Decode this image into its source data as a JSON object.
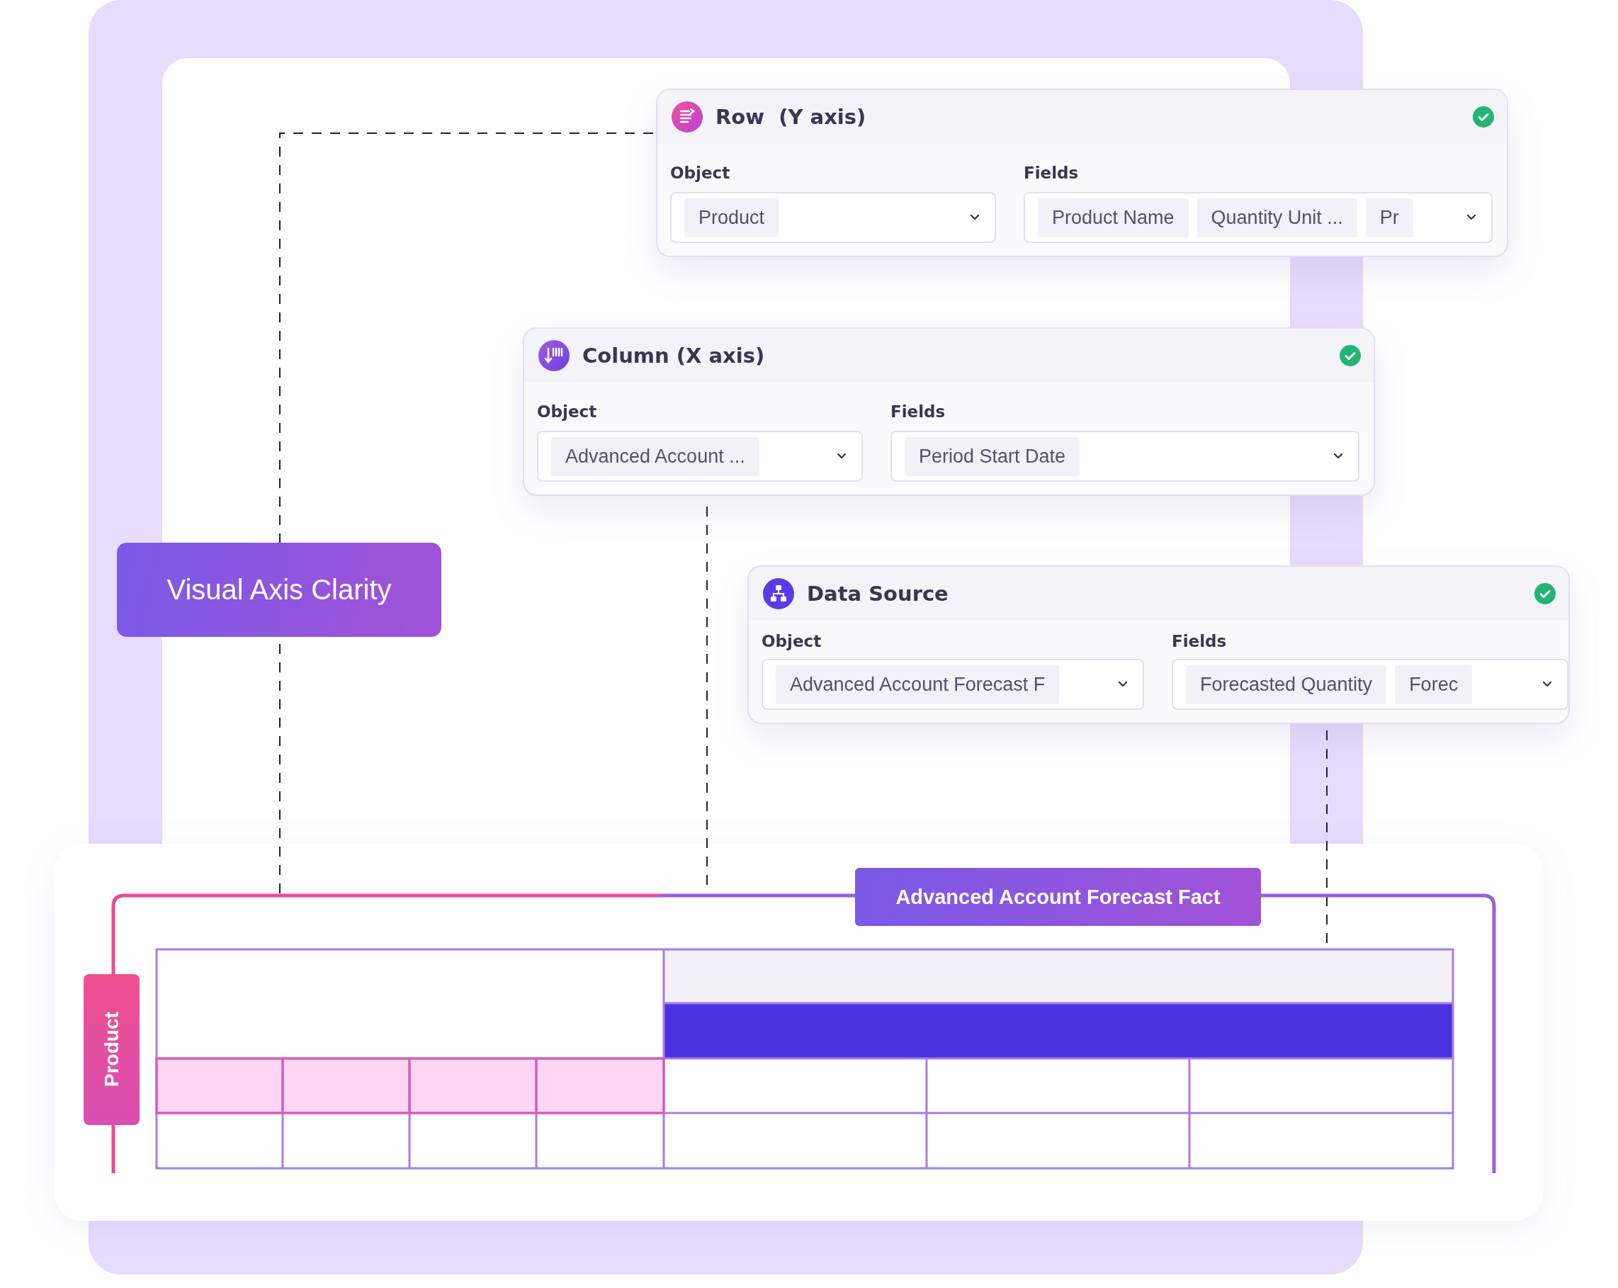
{
  "cards": [
    {
      "kind": "row",
      "title": "Row  (Y axis)",
      "valid": true,
      "object_label": "Object",
      "object_value": "Product",
      "fields_label": "Fields",
      "fields": [
        "Product Name",
        "Quantity Unit ...",
        "Pr"
      ]
    },
    {
      "kind": "column",
      "title": "Column (X axis)",
      "valid": true,
      "object_label": "Object",
      "object_value": "Advanced Account ...",
      "fields_label": "Fields",
      "fields": [
        "Period Start Date"
      ]
    },
    {
      "kind": "source",
      "title": "Data Source",
      "valid": true,
      "object_label": "Object",
      "object_value": "Advanced Account Forecast F",
      "fields_label": "Fields",
      "fields": [
        "Forecasted Quantity",
        "Forec"
      ]
    }
  ],
  "badge": "Visual Axis Clarity",
  "table": {
    "title": "Advanced Account Forecast Fact",
    "row_label": "Product"
  }
}
